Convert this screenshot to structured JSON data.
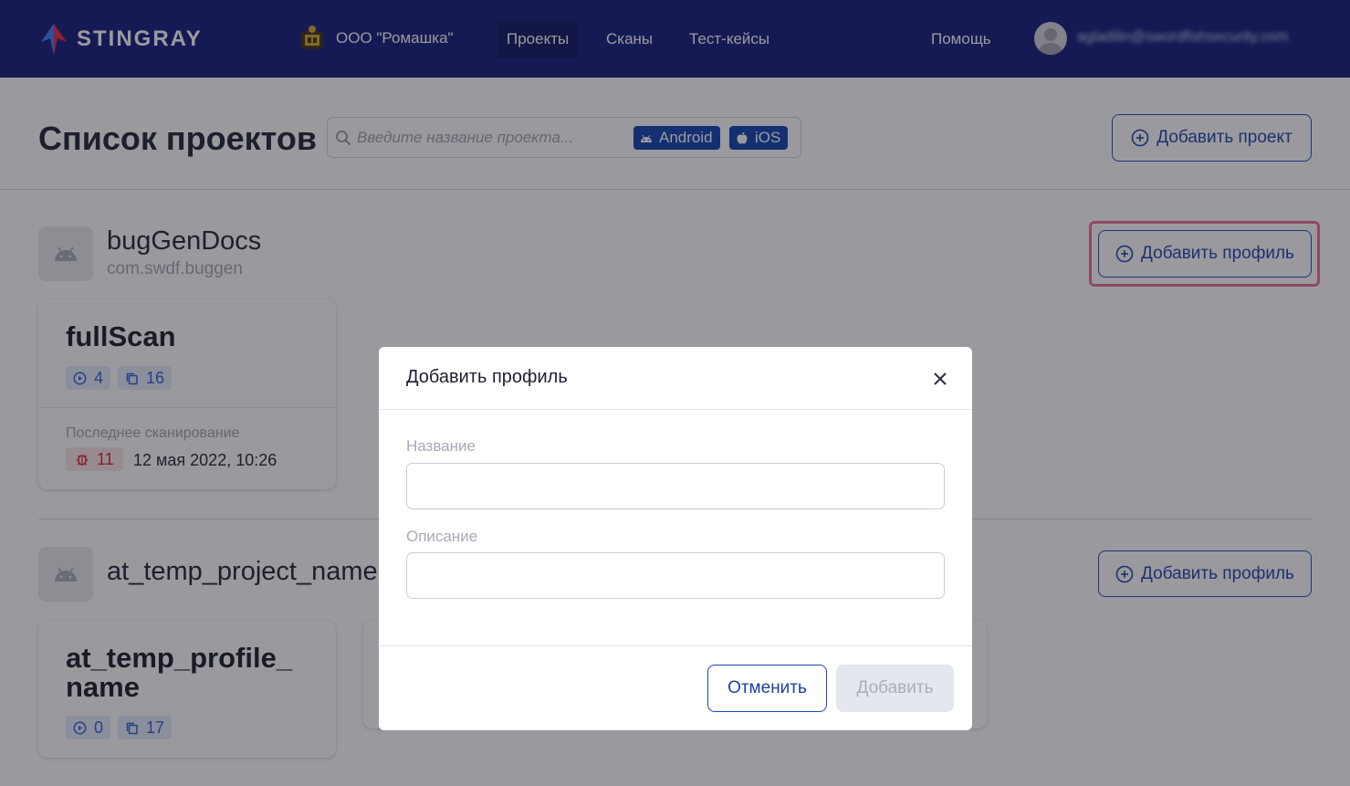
{
  "header": {
    "logo_text": "STINGRAY",
    "org_name": "ООО \"Ромашка\"",
    "nav": [
      {
        "label": "Проекты",
        "active": true
      },
      {
        "label": "Сканы",
        "active": false
      },
      {
        "label": "Тест-кейсы",
        "active": false
      }
    ],
    "help_label": "Помощь",
    "user_email": "agladilin@swordfishsecurity.com"
  },
  "page": {
    "title": "Список проектов",
    "search_placeholder": "Введите название проекта...",
    "filters": [
      {
        "label": "Android",
        "icon": "android-icon"
      },
      {
        "label": "iOS",
        "icon": "apple-icon"
      }
    ],
    "add_project_label": "Добавить проект"
  },
  "projects": [
    {
      "name": "bugGenDocs",
      "package": "com.swdf.buggen",
      "add_profile_label": "Добавить профиль",
      "profiles": [
        {
          "title": "fullScan",
          "scans": "4",
          "copies": "16",
          "last_scan_label": "Последнее сканирование",
          "bugs": "11",
          "last_scan_date": "12 мая 2022, 10:26"
        }
      ]
    },
    {
      "name": "at_temp_project_name",
      "package": "",
      "add_profile_label": "Добавить профиль",
      "profiles": [
        {
          "title_line1": "at_temp_profile_",
          "title_line2": "name",
          "scans": "0",
          "copies": "17"
        }
      ]
    }
  ],
  "modal": {
    "title": "Добавить профиль",
    "name_label": "Название",
    "name_value": "",
    "description_label": "Описание",
    "description_value": "",
    "cancel_label": "Отменить",
    "submit_label": "Добавить"
  },
  "colors": {
    "header_bg": "#0f1778",
    "primary": "#1d45b7",
    "highlight": "#f06b96",
    "danger": "#d42032"
  }
}
